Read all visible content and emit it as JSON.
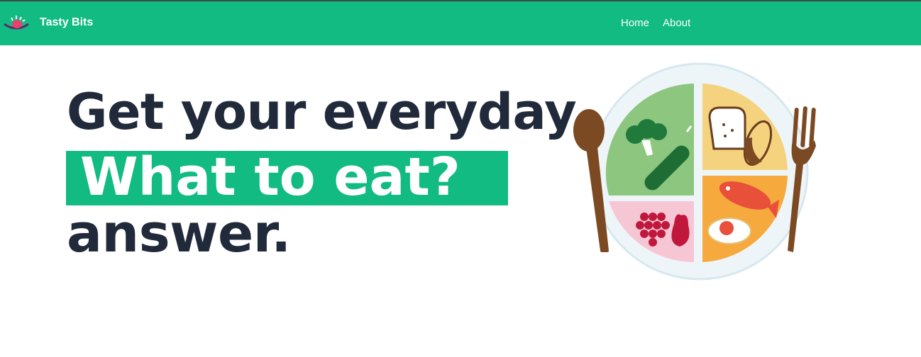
{
  "navbar": {
    "brand": "Tasty Bits",
    "links": [
      {
        "label": "Home"
      },
      {
        "label": "About"
      }
    ],
    "color": "#12bb81"
  },
  "hero": {
    "line1": "Get your everyday",
    "line2": "What to eat?",
    "line3": "answer.",
    "text_color": "#212a3a",
    "highlight_color": "#12bb81"
  },
  "illustration": {
    "icons": [
      "spoon-icon",
      "fork-icon",
      "plate-icon",
      "broccoli-icon",
      "cucumber-icon",
      "bread-icon",
      "corn-icon",
      "fish-icon",
      "egg-icon",
      "grapes-icon",
      "fruit-icon"
    ]
  }
}
